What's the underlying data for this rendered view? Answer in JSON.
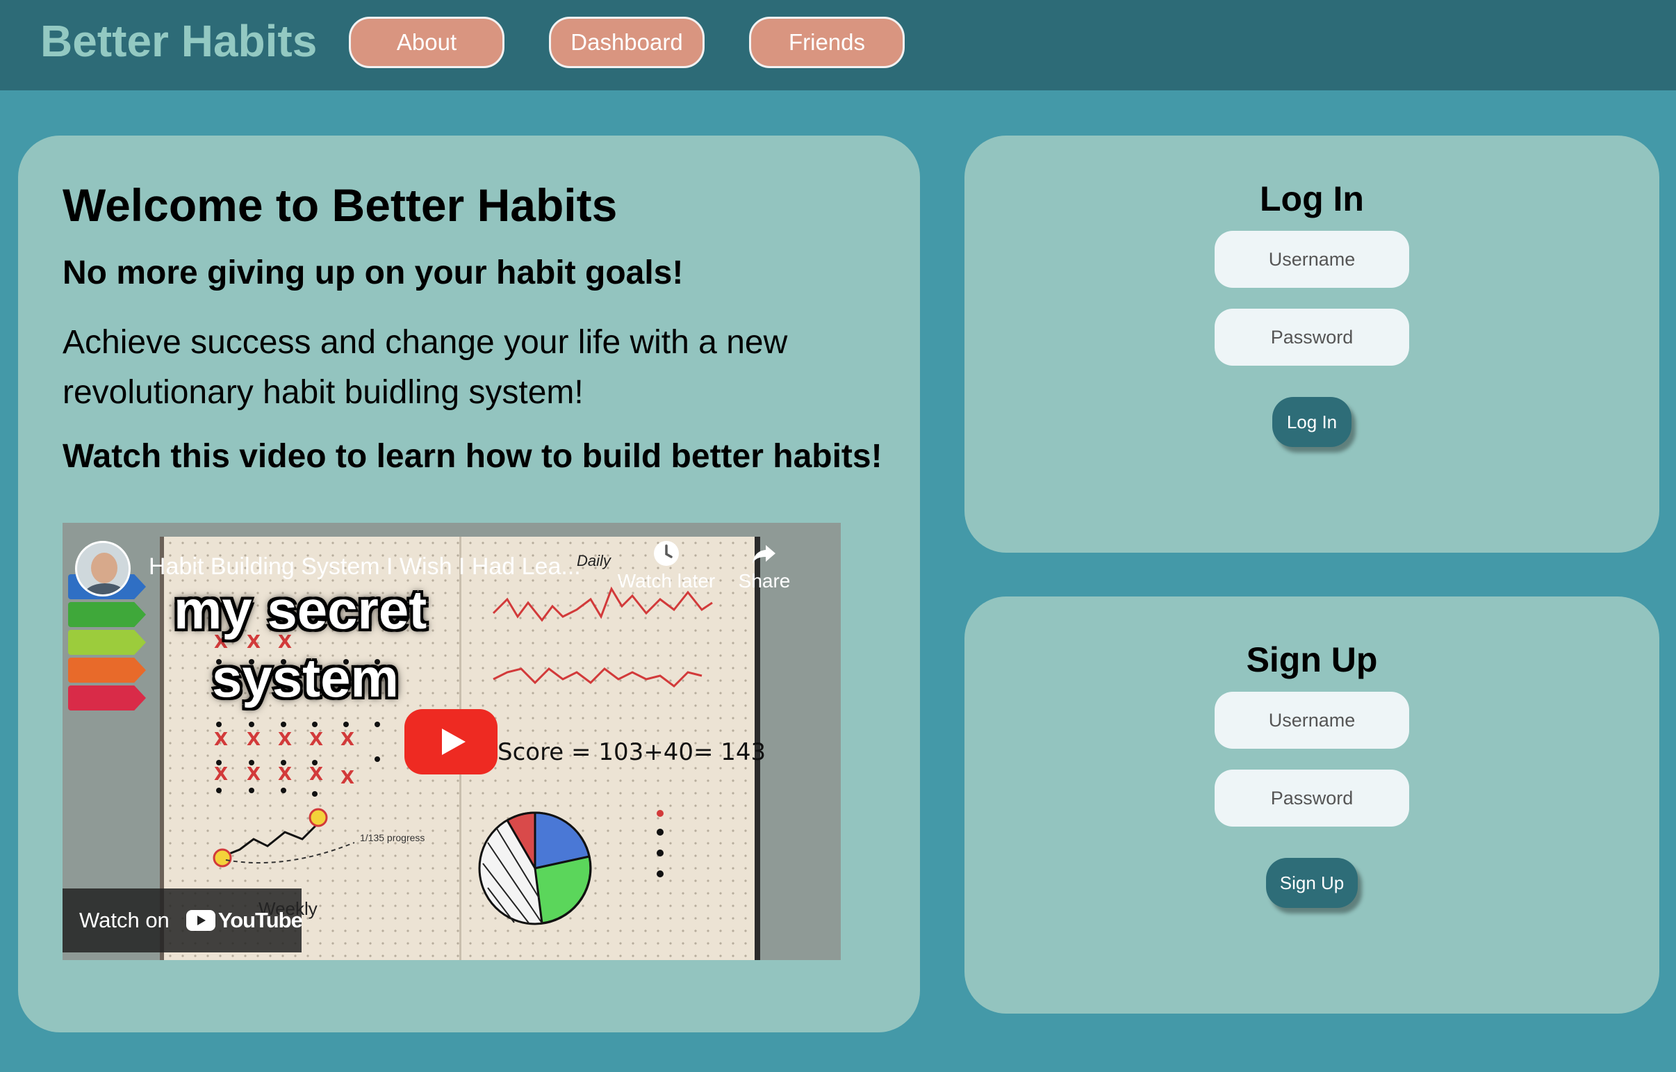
{
  "header": {
    "brand": "Better Habits",
    "nav": [
      {
        "label": "About"
      },
      {
        "label": "Dashboard"
      },
      {
        "label": "Friends"
      }
    ]
  },
  "main": {
    "title": "Welcome to Better Habits",
    "subtitle": "No more giving up on your habit goals!",
    "description": "Achieve success and change your life with a new revolutionary habit buidling system!",
    "video_prompt": "Watch this video to learn how to build better habits!",
    "video": {
      "title": "Habit Building System I Wish I Had Lea...",
      "thumbnail_text_1": "my secret",
      "thumbnail_text_2": "system",
      "watch_later": "Watch later",
      "share": "Share",
      "watch_on": "Watch on",
      "youtube": "YouTube",
      "score_text": "Score = 103+40= 143",
      "daily_label": "Daily",
      "progress_label": "1/135 progress",
      "weekly_label": "Weekly"
    }
  },
  "login": {
    "title": "Log In",
    "username_placeholder": "Username",
    "password_placeholder": "Password",
    "button": "Log In"
  },
  "signup": {
    "title": "Sign Up",
    "username_placeholder": "Username",
    "password_placeholder": "Password",
    "button": "Sign Up"
  },
  "colors": {
    "page_bg": "#4499a8",
    "header_bg": "#2d6b77",
    "brand": "#93c9c2",
    "nav_button": "#d99580",
    "card_bg": "#93c4bf",
    "action_button": "#2e6d78",
    "youtube_red": "#ee2a22"
  },
  "icons": {
    "play": "youtube-play-icon",
    "watch_later": "clock-icon",
    "share": "share-arrow-icon"
  }
}
